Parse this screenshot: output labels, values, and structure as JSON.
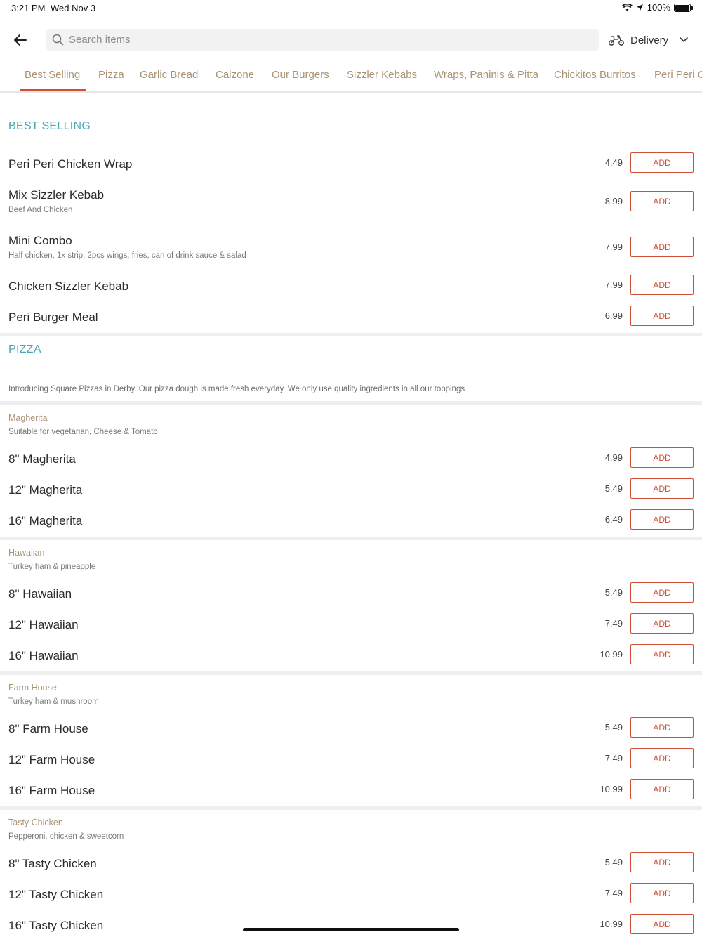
{
  "status": {
    "time": "3:21 PM",
    "date": "Wed Nov 3",
    "battery": "100%"
  },
  "header": {
    "search_placeholder": "Search items",
    "delivery_label": "Delivery"
  },
  "tabs": [
    {
      "label": "Best Selling",
      "active": true
    },
    {
      "label": "Pizza"
    },
    {
      "label": "Garlic Bread"
    },
    {
      "label": "Calzone"
    },
    {
      "label": "Our Burgers"
    },
    {
      "label": "Sizzler Kebabs"
    },
    {
      "label": "Wraps, Paninis & Pitta"
    },
    {
      "label": "Chickitos Burritos"
    },
    {
      "label": "Peri Peri C"
    }
  ],
  "add_label": "ADD",
  "best_selling": {
    "title": "BEST SELLING",
    "items": [
      {
        "name": "Peri Peri Chicken Wrap",
        "desc": "",
        "price": "4.49"
      },
      {
        "name": "Mix Sizzler Kebab",
        "desc": "Beef And Chicken",
        "price": "8.99"
      },
      {
        "name": "Mini Combo",
        "desc": "Half chicken, 1x strip, 2pcs wings, fries, can of drink sauce & salad",
        "price": "7.99"
      },
      {
        "name": "Chicken Sizzler Kebab",
        "desc": "",
        "price": "7.99"
      },
      {
        "name": "Peri Burger Meal",
        "desc": "",
        "price": "6.99"
      }
    ]
  },
  "pizza": {
    "title": "PIZZA",
    "intro": "Introducing Square Pizzas in Derby. Our pizza dough is made fresh everyday. We only use quality ingredients in all our toppings",
    "groups": [
      {
        "name": "Magherita",
        "desc": "Suitable for vegetarian, Cheese & Tomato",
        "items": [
          {
            "name": "8\" Magherita",
            "price": "4.99"
          },
          {
            "name": "12\" Magherita",
            "price": "5.49"
          },
          {
            "name": "16\" Magherita",
            "price": "6.49"
          }
        ]
      },
      {
        "name": "Hawaiian",
        "desc": "Turkey ham & pineapple",
        "items": [
          {
            "name": "8\" Hawaiian",
            "price": "5.49"
          },
          {
            "name": "12\" Hawaiian",
            "price": "7.49"
          },
          {
            "name": "16\" Hawaiian",
            "price": "10.99"
          }
        ]
      },
      {
        "name": "Farm House",
        "desc": "Turkey ham & mushroom",
        "items": [
          {
            "name": "8\" Farm House",
            "price": "5.49"
          },
          {
            "name": "12\" Farm House",
            "price": "7.49"
          },
          {
            "name": "16\" Farm House",
            "price": "10.99"
          }
        ]
      },
      {
        "name": "Tasty Chicken",
        "desc": "Pepperoni, chicken & sweetcorn",
        "items": [
          {
            "name": "8\" Tasty Chicken",
            "price": "5.49"
          },
          {
            "name": "12\" Tasty Chicken",
            "price": "7.49"
          },
          {
            "name": "16\" Tasty Chicken",
            "price": "10.99"
          }
        ]
      }
    ]
  },
  "colors": {
    "accent": "#cf4f34",
    "section": "#4ba6b3",
    "tab_text": "#a99373"
  },
  "icons": {
    "back": "arrow-left-icon",
    "search": "search-icon",
    "delivery": "scooter-icon",
    "chevron": "chevron-down-icon"
  }
}
